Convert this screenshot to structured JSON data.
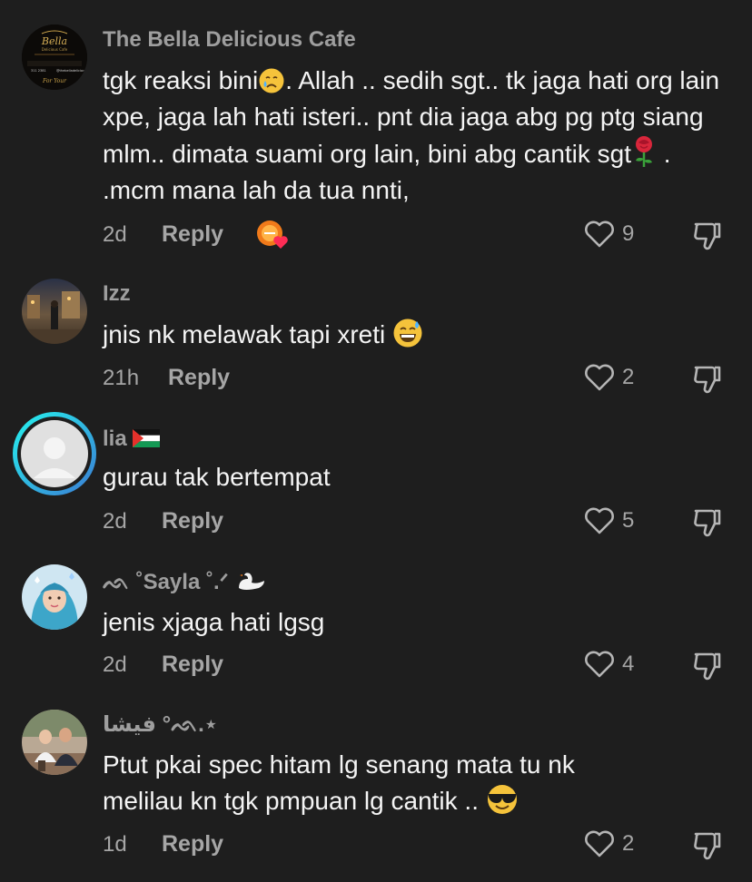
{
  "comments": [
    {
      "username": "The Bella Delicious Cafe",
      "text_parts": [
        "tgk reaksi bini",
        ". Allah .. sedih sgt.. tk jaga hati org lain xpe, jaga lah hati isteri.. pnt dia jaga abg pg ptg siang mlm.. dimata suami org lain, bini abg cantik sgt",
        " . .mcm mana lah da tua nnti,"
      ],
      "emojis": [
        "crying-face",
        "rose"
      ],
      "avatar_lines": [
        "Bella",
        "Delicious Cafe",
        "311 2381",
        "@thebelladeliciou",
        "For Your"
      ],
      "time": "2d",
      "reply_label": "Reply",
      "likes": "9",
      "creator_liked": true
    },
    {
      "username": "Izz",
      "text": "jnis nk melawak tapi xreti",
      "emoji": "grinning-sweat",
      "time": "21h",
      "reply_label": "Reply",
      "likes": "2"
    },
    {
      "username": "lia",
      "username_flag": "palestine-flag",
      "text": "gurau tak bertempat",
      "time": "2d",
      "reply_label": "Reply",
      "likes": "5"
    },
    {
      "username_prefix": "ᨒ ˚",
      "username": "Sayla",
      "username_suffix": " ˚.ᐟ",
      "username_emoji": "swan",
      "text": "jenis xjaga hati lgsg",
      "time": "2d",
      "reply_label": "Reply",
      "likes": "4"
    },
    {
      "username": "فيشا",
      "username_suffix": "°ᨒ.⋆",
      "text_line1": "Ptut pkai spec hitam lg senang mata tu nk",
      "text_line2": "melilau kn tgk pmpuan lg cantik .. ",
      "emoji": "sunglasses-face",
      "time": "1d",
      "reply_label": "Reply",
      "likes": "2"
    }
  ]
}
